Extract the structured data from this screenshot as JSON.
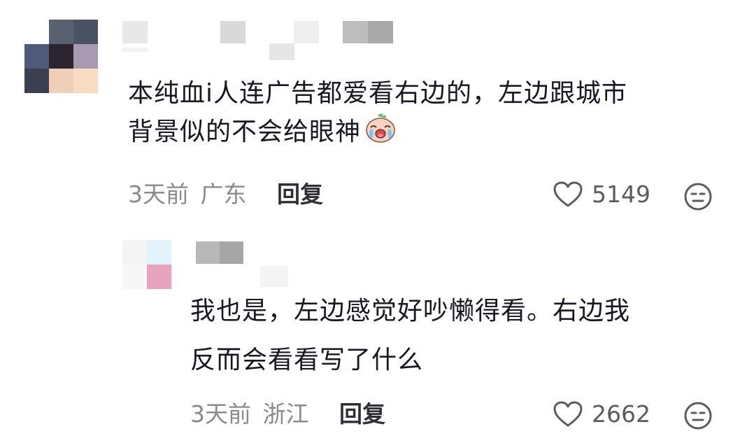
{
  "comments": [
    {
      "text_line1": "本纯血i人连广告都爱看右边的，左边跟城市",
      "text_line2": "背景似的不会给眼神",
      "sticker_icon": "crying-laughing-face-icon",
      "time": "3天前",
      "location": "广东",
      "reply_label": "回复",
      "like_count": "5149"
    },
    {
      "text_line1": "我也是，左边感觉好吵懒得看。右边我",
      "text_line2": "反而会看看写了什么",
      "time": "3天前",
      "location": "浙江",
      "reply_label": "回复",
      "like_count": "2662"
    }
  ],
  "icons": {
    "like": "heart-outline-icon",
    "dislike": "meh-face-icon"
  },
  "colors": {
    "text": "#161823",
    "meta": "#8a8b91",
    "reply": "#2f3037",
    "icon": "#5b5c63"
  }
}
